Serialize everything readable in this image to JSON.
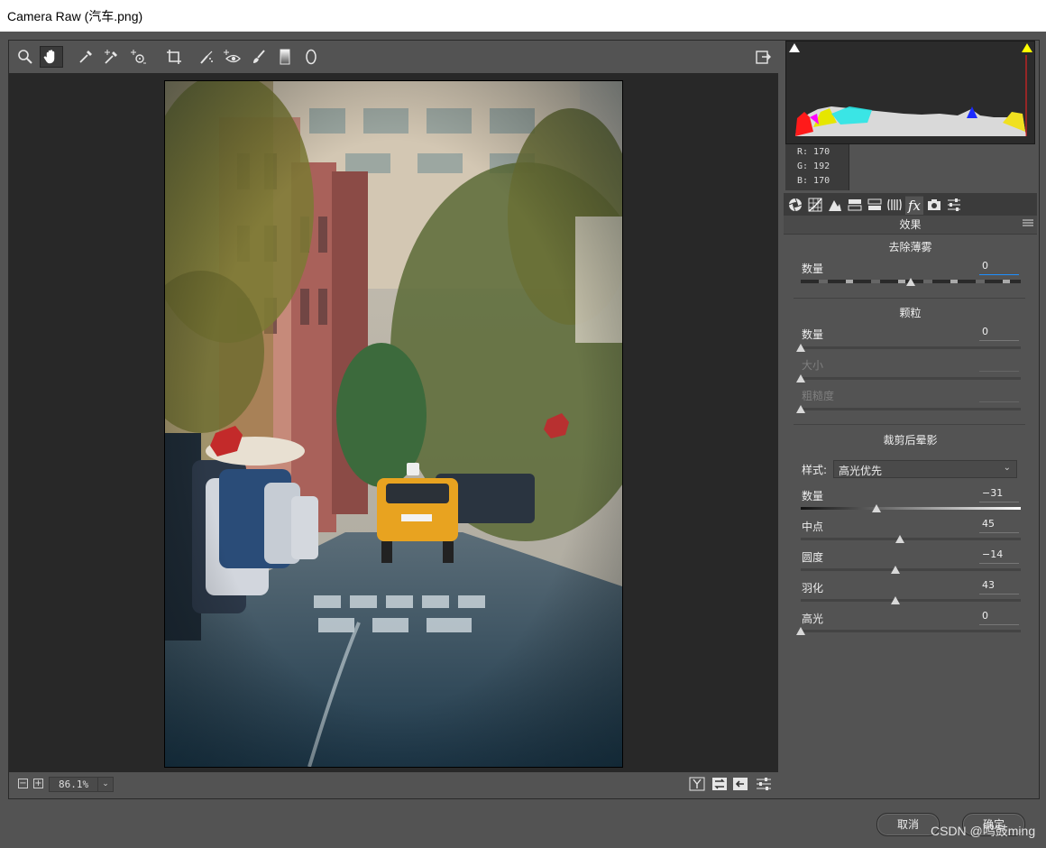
{
  "window": {
    "title": "Camera Raw (汽车.png)"
  },
  "toolbar": {
    "tools": [
      {
        "name": "zoom-tool",
        "icon": "magnifier-icon"
      },
      {
        "name": "hand-tool",
        "icon": "hand-icon"
      },
      {
        "name": "white-balance-tool",
        "icon": "eyedropper-icon"
      },
      {
        "name": "color-sampler-tool",
        "icon": "eyedropper-plus-icon"
      },
      {
        "name": "targeted-adjustment-tool",
        "icon": "target-adjust-icon"
      },
      {
        "name": "straighten-tool",
        "icon": "crop-icon"
      },
      {
        "name": "spot-removal-tool",
        "icon": "brush-spot-icon"
      },
      {
        "name": "red-eye-tool",
        "icon": "eye-plus-icon"
      },
      {
        "name": "adjustment-brush-tool",
        "icon": "brush-icon"
      },
      {
        "name": "graduated-filter-tool",
        "icon": "gradient-icon"
      },
      {
        "name": "radial-filter-tool",
        "icon": "ellipse-icon"
      }
    ],
    "active_tool": "hand-tool"
  },
  "zoom": {
    "value": "86.1%"
  },
  "histogram": {
    "readout": {
      "r": "R:  170",
      "g": "G:  192",
      "b": "B:  170"
    }
  },
  "panel": {
    "title": "效果",
    "sections": {
      "dehaze": {
        "title": "去除薄雾",
        "amount_label": "数量",
        "amount_value": "0",
        "amount_level": 0.5
      },
      "grain": {
        "title": "颗粒",
        "amount_label": "数量",
        "amount_value": "0",
        "amount_level": 0,
        "size_label": "大小",
        "size_level": 0,
        "roughness_label": "粗糙度",
        "roughness_level": 0
      },
      "vignette": {
        "title": "裁剪后晕影",
        "style_label": "样式:",
        "style_value": "高光优先",
        "sliders": [
          {
            "label": "数量",
            "value": "−31",
            "level": 0.345
          },
          {
            "label": "中点",
            "value": "45",
            "level": 0.45
          },
          {
            "label": "圆度",
            "value": "−14",
            "level": 0.43
          },
          {
            "label": "羽化",
            "value": "43",
            "level": 0.43
          },
          {
            "label": "高光",
            "value": "0",
            "level": 0
          }
        ]
      }
    }
  },
  "buttons": {
    "cancel": "取消",
    "ok": "确定"
  },
  "watermark": "CSDN @鸣鼓ming",
  "colors": {
    "accent": "#1e90ff",
    "clip_highlight": "#ffff00",
    "bg": "#535353"
  }
}
